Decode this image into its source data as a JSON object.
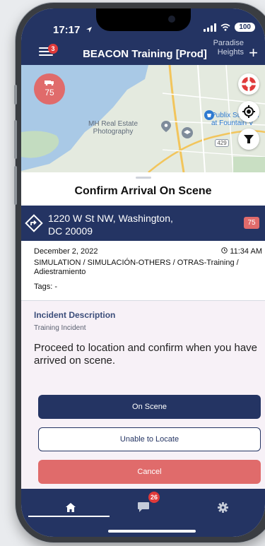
{
  "status": {
    "time": "17:17",
    "battery": "100"
  },
  "header": {
    "title": "BEACON Training [Prod]",
    "menu_badge": "3",
    "right_label_line1": "Paradise",
    "right_label_line2": "Heights",
    "plus": "+"
  },
  "map": {
    "unit_count": "75",
    "labels": {
      "mh_line1": "MH Real Estate",
      "mh_line2": "Photography",
      "publix_line1": "Publix Super M",
      "publix_line2": "at Fountain V",
      "route": "429"
    },
    "icons": [
      "life-ring-icon",
      "locate-icon",
      "filter-icon"
    ]
  },
  "sheet": {
    "title": "Confirm Arrival On Scene",
    "address_line1": "1220 W St NW, Washington,",
    "address_line2": "DC 20009",
    "address_badge": "75",
    "date": "December 2, 2022",
    "time": "11:34 AM",
    "type": "SIMULATION / SIMULACIÓN-OTHERS / OTRAS-Training / Adiestramiento",
    "tags": "Tags: -",
    "description_heading": "Incident Description",
    "description_text": "Training Incident",
    "prompt": "Proceed to location and confirm when you have arrived on scene.",
    "buttons": {
      "on_scene": "On Scene",
      "unable": "Unable to Locate",
      "cancel": "Cancel"
    }
  },
  "tabbar": {
    "messages_badge": "26"
  },
  "colors": {
    "navy": "#243463",
    "red": "#e06b6b",
    "badge": "#e03a3a",
    "sheet_bg": "#f7f1f7"
  }
}
